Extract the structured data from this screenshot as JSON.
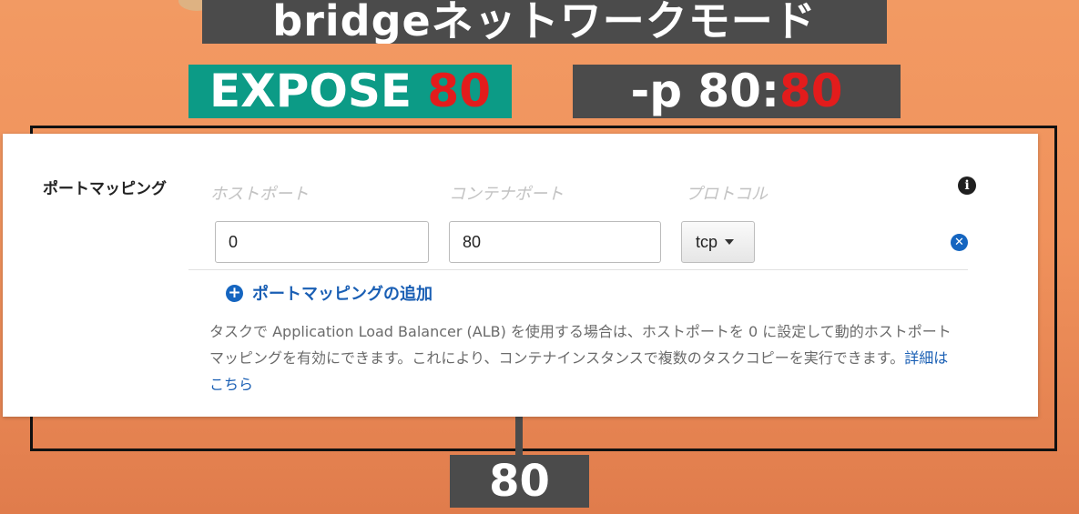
{
  "overlay": {
    "title": "bridgeネットワークモード",
    "expose_prefix": "EXPOSE ",
    "expose_port": "80",
    "publish_prefix": "-p 80:",
    "publish_port": "80",
    "bottom_port": "80"
  },
  "panel": {
    "section_label": "ポートマッピング",
    "columns": {
      "host_port": "ホストポート",
      "container_port": "コンテナポート",
      "protocol": "プロトコル"
    },
    "row": {
      "host_port_value": "0",
      "container_port_value": "80",
      "protocol_value": "tcp"
    },
    "add_mapping_label": "ポートマッピングの追加",
    "help_text": "タスクで Application Load Balancer (ALB) を使用する場合は、ホストポートを 0 に設定して動的ホストポートマッピングを有効にできます。これにより、コンテナインスタンスで複数のタスクコピーを実行できます。",
    "help_link": "詳細はこちら"
  },
  "icons": {
    "info": "info-icon",
    "remove": "close-circle-icon",
    "add": "plus-circle-icon",
    "dropdown": "caret-down-icon"
  },
  "colors": {
    "accent_blue": "#1a5fb4",
    "highlight_red": "#e31c1c",
    "expose_bg": "#0c9b86",
    "dark_bg": "#4b4b4b",
    "slide_bg": "#f29a63"
  }
}
